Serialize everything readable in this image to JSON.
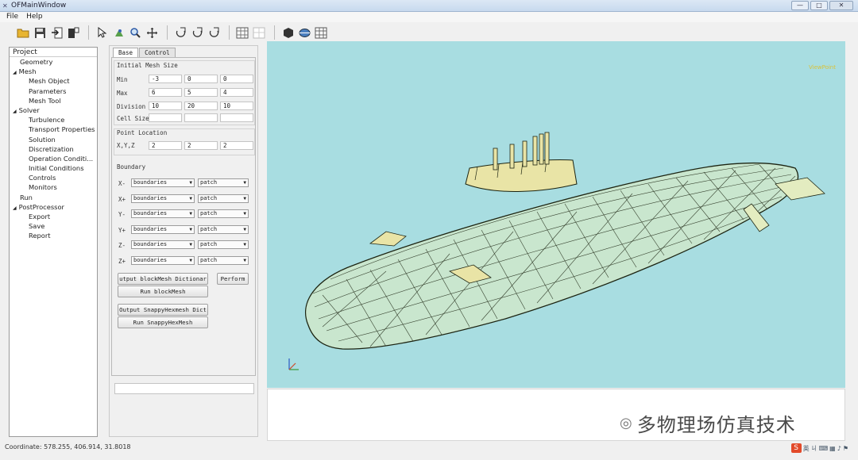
{
  "window": {
    "title": "OFMainWindow",
    "minimize": "—",
    "maximize": "□",
    "close": "✕"
  },
  "menu": [
    "File",
    "Help"
  ],
  "toolbar_icons": [
    "open-folder-icon",
    "save-icon",
    "import-icon",
    "export-icon",
    "pointer-icon",
    "rotate-icon",
    "zoom-icon",
    "pan-icon",
    "view-x-icon",
    "view-y-icon",
    "view-z-icon",
    "grid-icon",
    "mesh-grid-icon",
    "object-icon",
    "surface-icon",
    "wireframe-icon"
  ],
  "tree": {
    "header": "Project",
    "nodes": [
      {
        "label": "Geometry",
        "level": 0,
        "expander": ""
      },
      {
        "label": "Mesh",
        "level": 0,
        "expander": "◢"
      },
      {
        "label": "Mesh Object",
        "level": 1
      },
      {
        "label": "Parameters",
        "level": 1
      },
      {
        "label": "Mesh Tool",
        "level": 1
      },
      {
        "label": "Solver",
        "level": 0,
        "expander": "◢"
      },
      {
        "label": "Turbulence",
        "level": 1
      },
      {
        "label": "Transport Properties",
        "level": 1
      },
      {
        "label": "Solution",
        "level": 1
      },
      {
        "label": "Discretization",
        "level": 1
      },
      {
        "label": "Operation Conditi...",
        "level": 1
      },
      {
        "label": "Initial Conditions",
        "level": 1
      },
      {
        "label": "Controls",
        "level": 1
      },
      {
        "label": "Monitors",
        "level": 1
      },
      {
        "label": "Run",
        "level": 0,
        "expander": ""
      },
      {
        "label": "PostProcessor",
        "level": 0,
        "expander": "◢"
      },
      {
        "label": "Export",
        "level": 1
      },
      {
        "label": "Save",
        "level": 1
      },
      {
        "label": "Report",
        "level": 1
      }
    ]
  },
  "panel": {
    "tabs": [
      "Base",
      "Control"
    ],
    "initial_mesh": {
      "title": "Initial Mesh Size",
      "rows": [
        {
          "label": "Min",
          "values": [
            "-3",
            "0",
            "0"
          ]
        },
        {
          "label": "Max",
          "values": [
            "6",
            "5",
            "4"
          ]
        },
        {
          "label": "Division",
          "values": [
            "10",
            "20",
            "10"
          ]
        },
        {
          "label": "Cell Size",
          "values": [
            "",
            "",
            ""
          ]
        }
      ]
    },
    "point_location": {
      "title": "Point Location",
      "label": "X,Y,Z",
      "values": [
        "2",
        "2",
        "2"
      ]
    },
    "boundary": {
      "title": "Boundary",
      "rows": [
        {
          "label": "X-",
          "name": "boundaries",
          "type": "patch"
        },
        {
          "label": "X+",
          "name": "boundaries",
          "type": "patch"
        },
        {
          "label": "Y-",
          "name": "boundaries",
          "type": "patch"
        },
        {
          "label": "Y+",
          "name": "boundaries",
          "type": "patch"
        },
        {
          "label": "Z-",
          "name": "boundaries",
          "type": "patch"
        },
        {
          "label": "Z+",
          "name": "boundaries",
          "type": "patch"
        }
      ]
    },
    "buttons": {
      "output_blockmesh": "utput blockMesh Dictionar",
      "perform": "Perform",
      "run_blockmesh": "Run blockMesh",
      "output_snappy": "Output SnappyHexmesh Dict",
      "run_snappy": "Run SnappyHexMesh"
    }
  },
  "viewport": {
    "label": "ViewPoint",
    "background": "#a8dde1",
    "wire_color": "#1c2412",
    "accent_color": "#e9e4a6"
  },
  "status": {
    "coordinate": "Coordinate: 578.255, 406.914, 31.8018"
  },
  "watermark": {
    "text": "多物理场仿真技术"
  },
  "tray": {
    "logo": "S",
    "items": [
      "英",
      "ㄐ",
      "⌨",
      "▦",
      "♪",
      "⚑"
    ]
  }
}
